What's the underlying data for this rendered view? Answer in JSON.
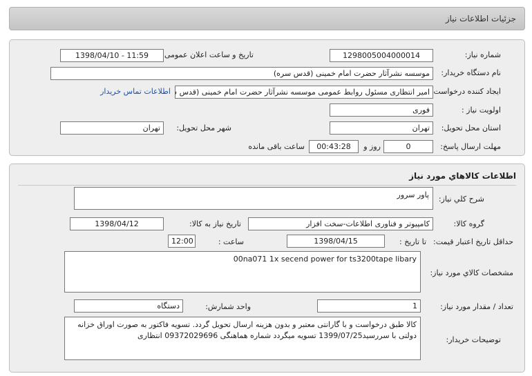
{
  "header": {
    "title": "جزئیات اطلاعات نیاز"
  },
  "need_info": {
    "need_number_label": "شماره نیاز:",
    "need_number": "1298005004000014",
    "announce_label": "تاریخ و ساعت اعلان عمومی:",
    "announce_value": "1398/04/10 - 11:59",
    "buyer_org_label": "نام دستگاه خریدار:",
    "buyer_org": "موسسه نشرآثار حضرت امام خمینی (قدس سره)",
    "requester_label": "ایجاد کننده درخواست:",
    "requester": "امیر انتظاری مسئول روابط عمومی موسسه نشرآثار حضرت امام خمینی (قدس س",
    "contact_link": "اطلاعات تماس خریدار",
    "priority_label": "اولویت نیاز :",
    "priority": "فوری",
    "province_label": "استان محل تحویل:",
    "province": "تهران",
    "city_label": "شهر محل تحویل:",
    "city": "تهران",
    "deadline_label": "مهلت ارسال پاسخ:",
    "deadline_days": "0",
    "days_word": "روز و",
    "deadline_time": "00:43:28",
    "remaining_word": "ساعت باقی مانده"
  },
  "goods": {
    "section_title": "اطلاعات کالاهاي مورد نياز",
    "general_desc_label": "شرح کلي نياز:",
    "general_desc": "پاور سرور",
    "group_label": "گروه کالا:",
    "group": "کامپیوتر و فناوری اطلاعات-سخت افزار",
    "need_date_label": "تاریخ نیاز به کالا:",
    "need_date": "1398/04/12",
    "validity_label": "حداقل تاریخ اعتبار قیمت:",
    "until_date_label": "تا تاریخ :",
    "until_date": "1398/04/15",
    "hour_label": "ساعت :",
    "hour": "12:00",
    "specs_label": "مشخصات کالاي مورد نياز:",
    "specs": "00na071  1x secend power for ts3200tape libary",
    "qty_label": "تعداد / مقدار مورد نیاز:",
    "qty": "1",
    "unit_label": "واحد شمارش:",
    "unit": "دستگاه",
    "buyer_notes_label": "توضیحات خریدار:",
    "buyer_notes": "کالا طبق درخواست و با گارانتی معتبر و بدون هزینه ارسال  تحویل گردد. تسویه فاکتور به صورت اوراق خزانه دولتی با سررسید1399/07/25 تسویه میگردد شماره هماهنگی 09372029696 انتظاری"
  }
}
